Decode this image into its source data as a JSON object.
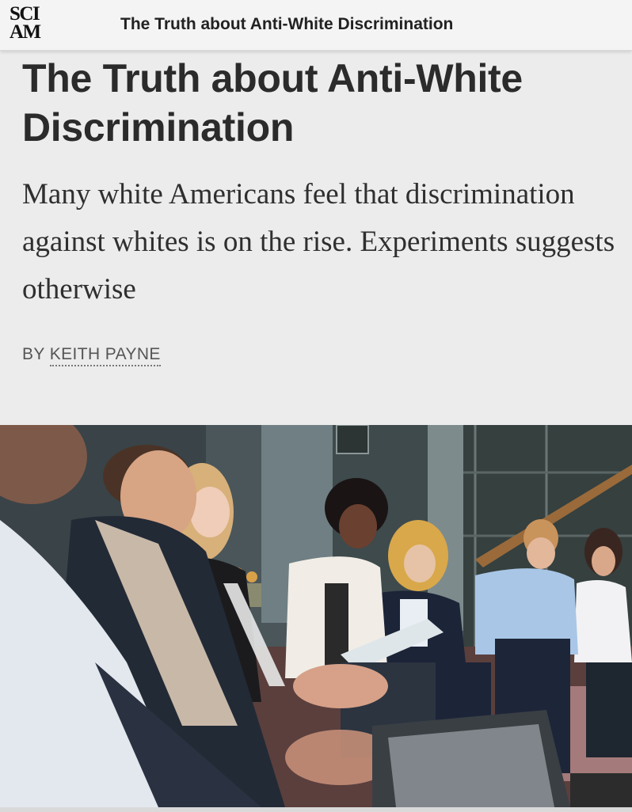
{
  "header": {
    "logo_line1": "SCI",
    "logo_line2": "AM",
    "title": "The Truth about Anti-White Discrimination"
  },
  "article": {
    "headline": "The Truth about Anti-White Discrimination",
    "dek": "Many white Americans feel that discrimination against whites is on the rise. Experiments suggests otherwise",
    "byline_prefix": "BY",
    "author": "KEITH PAYNE"
  },
  "hero": {
    "image_alt": ""
  },
  "colors": {
    "background": "#ececec",
    "headline": "#2b2b2b",
    "byline": "#555555"
  }
}
